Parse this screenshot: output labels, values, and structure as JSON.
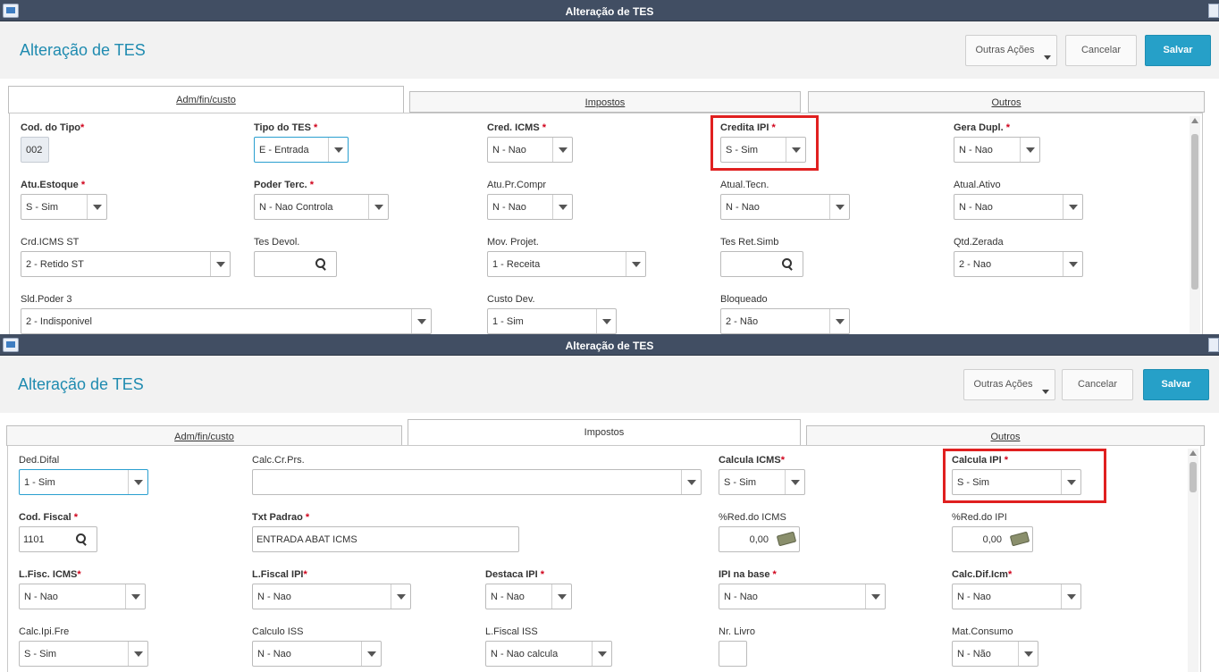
{
  "w1": {
    "window_title": "Alteração de TES",
    "page_title": "Alteração de TES",
    "buttons": {
      "more": "Outras Ações",
      "cancel": "Cancelar",
      "save": "Salvar"
    },
    "tabs": {
      "adm": "Adm/fin/custo",
      "impostos": "Impostos",
      "outros": "Outros"
    },
    "fields": {
      "cod_tipo": {
        "label": "Cod. do Tipo",
        "value": "002",
        "required": "*"
      },
      "tipo_tes": {
        "label": "Tipo do TES",
        "value": "E - Entrada",
        "required": "*"
      },
      "cred_icms": {
        "label": "Cred. ICMS",
        "value": "N - Nao",
        "required": "*"
      },
      "credita_ipi": {
        "label": "Credita IPI",
        "value": "S - Sim",
        "required": "*"
      },
      "gera_dupl": {
        "label": "Gera Dupl.",
        "value": "N - Nao",
        "required": "*"
      },
      "atu_estoque": {
        "label": "Atu.Estoque",
        "value": "S - Sim",
        "required": "*"
      },
      "poder_terc": {
        "label": "Poder Terc.",
        "value": "N - Nao Controla",
        "required": "*"
      },
      "atu_pr_compr": {
        "label": "Atu.Pr.Compr",
        "value": "N - Nao"
      },
      "atual_tecn": {
        "label": "Atual.Tecn.",
        "value": "N - Nao"
      },
      "atual_ativo": {
        "label": "Atual.Ativo",
        "value": "N - Nao"
      },
      "crd_icms_st": {
        "label": "Crd.ICMS ST",
        "value": "2 - Retido ST"
      },
      "tes_devol": {
        "label": "Tes Devol.",
        "value": ""
      },
      "mov_projet": {
        "label": "Mov. Projet.",
        "value": "1 - Receita"
      },
      "tes_ret_simb": {
        "label": "Tes Ret.Simb",
        "value": ""
      },
      "qtd_zerada": {
        "label": "Qtd.Zerada",
        "value": "2 - Nao"
      },
      "sld_poder3": {
        "label": "Sld.Poder 3",
        "value": "2 - Indisponivel"
      },
      "custo_dev": {
        "label": "Custo Dev.",
        "value": "1 - Sim"
      },
      "bloqueado": {
        "label": "Bloqueado",
        "value": "2 - Não"
      }
    }
  },
  "w2": {
    "window_title": "Alteração de TES",
    "page_title": "Alteração de TES",
    "buttons": {
      "more": "Outras Ações",
      "cancel": "Cancelar",
      "save": "Salvar"
    },
    "tabs": {
      "adm": "Adm/fin/custo",
      "impostos": "Impostos",
      "outros": "Outros"
    },
    "fields": {
      "ded_difal": {
        "label": "Ded.Difal",
        "value": "1 - Sim"
      },
      "calc_cr_prs": {
        "label": "Calc.Cr.Prs.",
        "value": ""
      },
      "calcula_icms": {
        "label": "Calcula ICMS",
        "value": "S - Sim",
        "required": "*"
      },
      "calcula_ipi": {
        "label": "Calcula IPI",
        "value": "S - Sim",
        "required": "*"
      },
      "cod_fiscal": {
        "label": "Cod. Fiscal",
        "value": "1101",
        "required": "*"
      },
      "txt_padrao": {
        "label": "Txt Padrao",
        "value": "ENTRADA ABAT ICMS",
        "required": "*"
      },
      "red_icms": {
        "label": "%Red.do ICMS",
        "value": "0,00"
      },
      "red_ipi": {
        "label": "%Red.do IPI",
        "value": "0,00"
      },
      "lfisc_icms": {
        "label": "L.Fisc. ICMS",
        "value": "N - Nao",
        "required": "*"
      },
      "lfiscal_ipi": {
        "label": "L.Fiscal IPI",
        "value": "N - Nao",
        "required": "*"
      },
      "destaca_ipi": {
        "label": "Destaca IPI",
        "value": "N - Nao",
        "required": "*"
      },
      "ipi_na_base": {
        "label": "IPI na base",
        "value": "N - Nao",
        "required": "*"
      },
      "calc_dif_icm": {
        "label": "Calc.Dif.Icm",
        "value": "N - Nao",
        "required": "*"
      },
      "calc_ipi_fre": {
        "label": "Calc.Ipi.Fre",
        "value": "S - Sim"
      },
      "calculo_iss": {
        "label": "Calculo ISS",
        "value": "N - Nao"
      },
      "lfiscal_iss": {
        "label": "L.Fiscal ISS",
        "value": "N - Nao calcula"
      },
      "nr_livro": {
        "label": "Nr. Livro",
        "value": ""
      },
      "mat_consumo": {
        "label": "Mat.Consumo",
        "value": "N - Não"
      }
    }
  }
}
